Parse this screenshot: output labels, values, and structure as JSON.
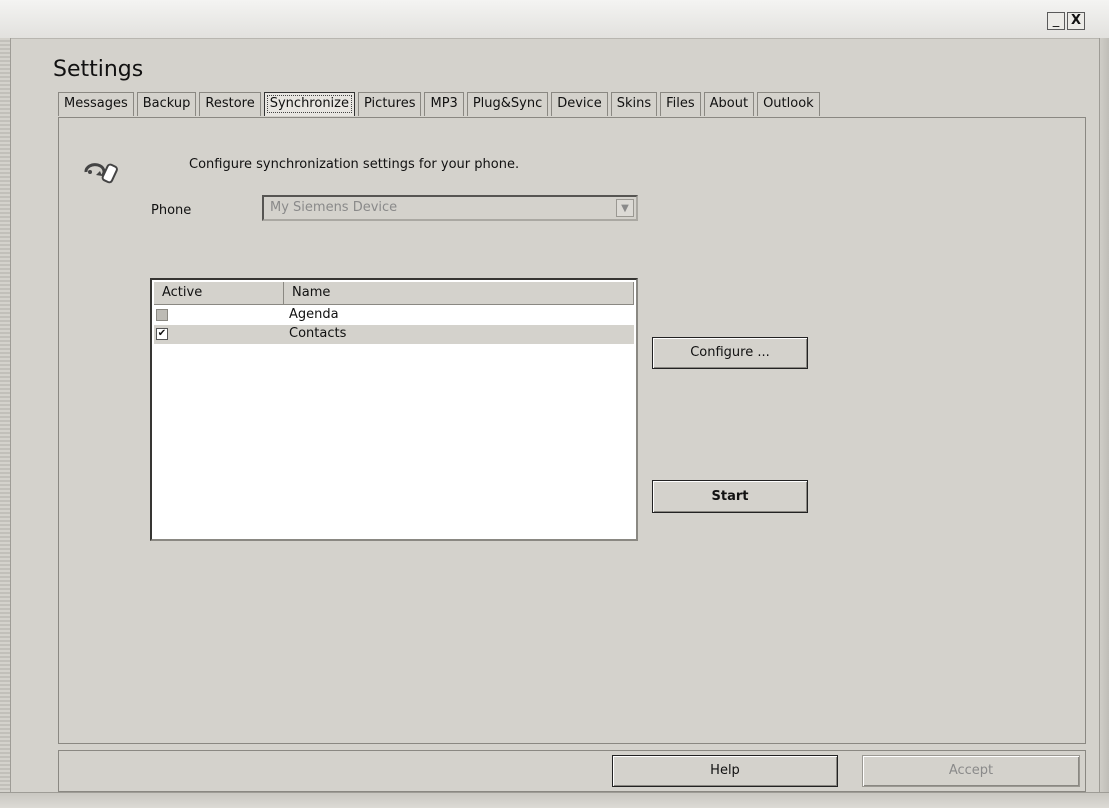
{
  "window": {
    "minimize_label": "_",
    "close_label": "X",
    "title": "Settings"
  },
  "tabs": [
    {
      "label": "Messages"
    },
    {
      "label": "Backup"
    },
    {
      "label": "Restore"
    },
    {
      "label": "Synchronize",
      "active": true
    },
    {
      "label": "Pictures"
    },
    {
      "label": "MP3"
    },
    {
      "label": "Plug&Sync"
    },
    {
      "label": "Device"
    },
    {
      "label": "Skins"
    },
    {
      "label": "Files"
    },
    {
      "label": "About"
    },
    {
      "label": "Outlook"
    }
  ],
  "sync": {
    "icon": "sync-phone-icon",
    "description": "Configure synchronization settings for your phone.",
    "phone_label": "Phone",
    "phone_value": "My Siemens Device",
    "dropdown_arrow": "▼"
  },
  "list": {
    "columns": [
      "Active",
      "Name"
    ],
    "rows": [
      {
        "active": false,
        "name": "Agenda",
        "check": ""
      },
      {
        "active": true,
        "name": "Contacts",
        "check": "✔"
      }
    ]
  },
  "buttons": {
    "configure": "Configure ...",
    "start": "Start",
    "help": "Help",
    "accept": "Accept"
  }
}
